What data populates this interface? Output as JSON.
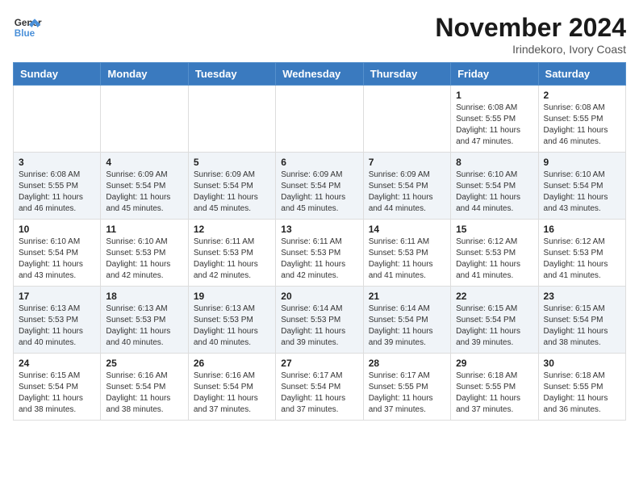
{
  "header": {
    "logo_line1": "General",
    "logo_line2": "Blue",
    "month": "November 2024",
    "location": "Irindekoro, Ivory Coast"
  },
  "days_of_week": [
    "Sunday",
    "Monday",
    "Tuesday",
    "Wednesday",
    "Thursday",
    "Friday",
    "Saturday"
  ],
  "weeks": [
    [
      {
        "day": "",
        "info": ""
      },
      {
        "day": "",
        "info": ""
      },
      {
        "day": "",
        "info": ""
      },
      {
        "day": "",
        "info": ""
      },
      {
        "day": "",
        "info": ""
      },
      {
        "day": "1",
        "info": "Sunrise: 6:08 AM\nSunset: 5:55 PM\nDaylight: 11 hours and 47 minutes."
      },
      {
        "day": "2",
        "info": "Sunrise: 6:08 AM\nSunset: 5:55 PM\nDaylight: 11 hours and 46 minutes."
      }
    ],
    [
      {
        "day": "3",
        "info": "Sunrise: 6:08 AM\nSunset: 5:55 PM\nDaylight: 11 hours and 46 minutes."
      },
      {
        "day": "4",
        "info": "Sunrise: 6:09 AM\nSunset: 5:54 PM\nDaylight: 11 hours and 45 minutes."
      },
      {
        "day": "5",
        "info": "Sunrise: 6:09 AM\nSunset: 5:54 PM\nDaylight: 11 hours and 45 minutes."
      },
      {
        "day": "6",
        "info": "Sunrise: 6:09 AM\nSunset: 5:54 PM\nDaylight: 11 hours and 45 minutes."
      },
      {
        "day": "7",
        "info": "Sunrise: 6:09 AM\nSunset: 5:54 PM\nDaylight: 11 hours and 44 minutes."
      },
      {
        "day": "8",
        "info": "Sunrise: 6:10 AM\nSunset: 5:54 PM\nDaylight: 11 hours and 44 minutes."
      },
      {
        "day": "9",
        "info": "Sunrise: 6:10 AM\nSunset: 5:54 PM\nDaylight: 11 hours and 43 minutes."
      }
    ],
    [
      {
        "day": "10",
        "info": "Sunrise: 6:10 AM\nSunset: 5:54 PM\nDaylight: 11 hours and 43 minutes."
      },
      {
        "day": "11",
        "info": "Sunrise: 6:10 AM\nSunset: 5:53 PM\nDaylight: 11 hours and 42 minutes."
      },
      {
        "day": "12",
        "info": "Sunrise: 6:11 AM\nSunset: 5:53 PM\nDaylight: 11 hours and 42 minutes."
      },
      {
        "day": "13",
        "info": "Sunrise: 6:11 AM\nSunset: 5:53 PM\nDaylight: 11 hours and 42 minutes."
      },
      {
        "day": "14",
        "info": "Sunrise: 6:11 AM\nSunset: 5:53 PM\nDaylight: 11 hours and 41 minutes."
      },
      {
        "day": "15",
        "info": "Sunrise: 6:12 AM\nSunset: 5:53 PM\nDaylight: 11 hours and 41 minutes."
      },
      {
        "day": "16",
        "info": "Sunrise: 6:12 AM\nSunset: 5:53 PM\nDaylight: 11 hours and 41 minutes."
      }
    ],
    [
      {
        "day": "17",
        "info": "Sunrise: 6:13 AM\nSunset: 5:53 PM\nDaylight: 11 hours and 40 minutes."
      },
      {
        "day": "18",
        "info": "Sunrise: 6:13 AM\nSunset: 5:53 PM\nDaylight: 11 hours and 40 minutes."
      },
      {
        "day": "19",
        "info": "Sunrise: 6:13 AM\nSunset: 5:53 PM\nDaylight: 11 hours and 40 minutes."
      },
      {
        "day": "20",
        "info": "Sunrise: 6:14 AM\nSunset: 5:53 PM\nDaylight: 11 hours and 39 minutes."
      },
      {
        "day": "21",
        "info": "Sunrise: 6:14 AM\nSunset: 5:54 PM\nDaylight: 11 hours and 39 minutes."
      },
      {
        "day": "22",
        "info": "Sunrise: 6:15 AM\nSunset: 5:54 PM\nDaylight: 11 hours and 39 minutes."
      },
      {
        "day": "23",
        "info": "Sunrise: 6:15 AM\nSunset: 5:54 PM\nDaylight: 11 hours and 38 minutes."
      }
    ],
    [
      {
        "day": "24",
        "info": "Sunrise: 6:15 AM\nSunset: 5:54 PM\nDaylight: 11 hours and 38 minutes."
      },
      {
        "day": "25",
        "info": "Sunrise: 6:16 AM\nSunset: 5:54 PM\nDaylight: 11 hours and 38 minutes."
      },
      {
        "day": "26",
        "info": "Sunrise: 6:16 AM\nSunset: 5:54 PM\nDaylight: 11 hours and 37 minutes."
      },
      {
        "day": "27",
        "info": "Sunrise: 6:17 AM\nSunset: 5:54 PM\nDaylight: 11 hours and 37 minutes."
      },
      {
        "day": "28",
        "info": "Sunrise: 6:17 AM\nSunset: 5:55 PM\nDaylight: 11 hours and 37 minutes."
      },
      {
        "day": "29",
        "info": "Sunrise: 6:18 AM\nSunset: 5:55 PM\nDaylight: 11 hours and 37 minutes."
      },
      {
        "day": "30",
        "info": "Sunrise: 6:18 AM\nSunset: 5:55 PM\nDaylight: 11 hours and 36 minutes."
      }
    ]
  ]
}
